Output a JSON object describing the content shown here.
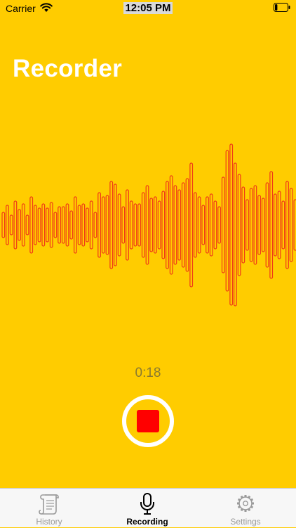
{
  "status_bar": {
    "carrier": "Carrier",
    "time": "12:05 PM",
    "wifi_icon": "wifi-icon",
    "battery_icon": "battery-icon",
    "battery_level": 0.2
  },
  "header": {
    "title": "Recorder"
  },
  "recording": {
    "elapsed": "0:18",
    "stop_icon": "stop-icon",
    "accent_color": "#FF0000",
    "background_color": "#FFCC00"
  },
  "tab_bar": {
    "tabs": [
      {
        "label": "History",
        "icon": "scroll-icon",
        "active": false
      },
      {
        "label": "Recording",
        "icon": "microphone-icon",
        "active": true
      },
      {
        "label": "Settings",
        "icon": "gear-icon",
        "active": false
      }
    ]
  }
}
